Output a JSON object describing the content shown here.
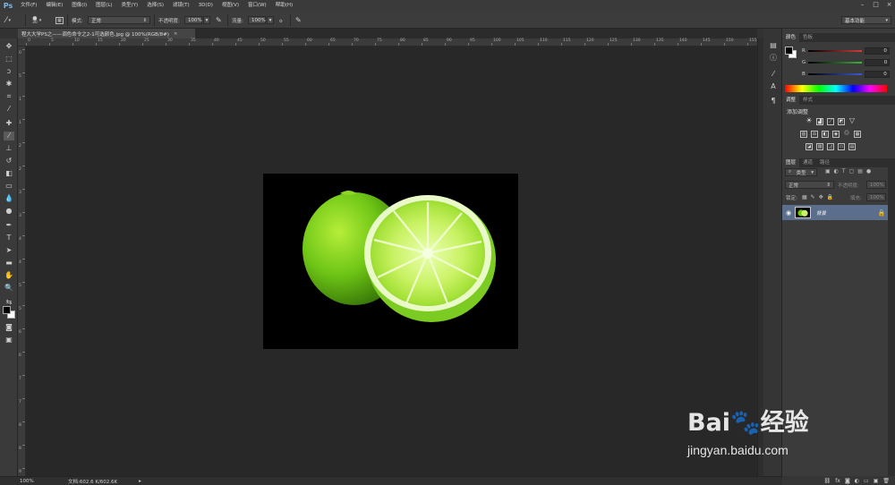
{
  "app": {
    "logo": "Ps"
  },
  "menu": [
    "文件(F)",
    "编辑(E)",
    "图像(I)",
    "图层(L)",
    "类型(Y)",
    "选择(S)",
    "滤镜(T)",
    "3D(D)",
    "视图(V)",
    "窗口(W)",
    "帮助(H)"
  ],
  "options_bar": {
    "brush_size": "30",
    "mode_label": "模式:",
    "mode_value": "正常",
    "opacity_label": "不透明度:",
    "opacity_value": "100%",
    "flow_label": "流量:",
    "flow_value": "100%",
    "workspace": "基本功能"
  },
  "document_tab": {
    "title": "程大大学PS之——调色命令之2-1可选颜色.jpg @ 100%(RGB/8#)",
    "close": "×"
  },
  "ruler_top_labels": [
    "0",
    "5",
    "10",
    "15",
    "20",
    "25",
    "30",
    "35",
    "40",
    "45",
    "50",
    "55",
    "60",
    "65",
    "70",
    "75",
    "80",
    "85",
    "90",
    "95",
    "100",
    "105",
    "110",
    "115",
    "120",
    "125",
    "130",
    "135",
    "140",
    "145",
    "150",
    "155"
  ],
  "ruler_left_labels": [
    "0",
    "5",
    "1",
    "1",
    "2",
    "2",
    "3",
    "3",
    "4",
    "4",
    "5",
    "5",
    "6",
    "6",
    "7",
    "7",
    "8",
    "8",
    "9"
  ],
  "color_panel": {
    "tabs": [
      "颜色",
      "色板"
    ],
    "channels": [
      {
        "label": "R",
        "value": "0",
        "color": "#d23c3c"
      },
      {
        "label": "G",
        "value": "0",
        "color": "#3cb43c"
      },
      {
        "label": "B",
        "value": "0",
        "color": "#3c5ad2"
      }
    ]
  },
  "adjustments_panel": {
    "tabs": [
      "调整",
      "样式"
    ],
    "title": "添加调整"
  },
  "layers_panel": {
    "tabs": [
      "图层",
      "通道",
      "路径"
    ],
    "filter_kind": "类型",
    "blend_mode": "正常",
    "opacity_label": "不透明度:",
    "opacity_value": "100%",
    "lock_label": "锁定:",
    "fill_label": "填充:",
    "fill_value": "100%",
    "layer_name": "背景"
  },
  "status_bar": {
    "zoom": "100%",
    "doc_info": "文档:602.6 K/602.6K",
    "arrow": "▸"
  },
  "watermark": {
    "logo": "Bai🐾经验",
    "url": "jingyan.baidu.com"
  }
}
